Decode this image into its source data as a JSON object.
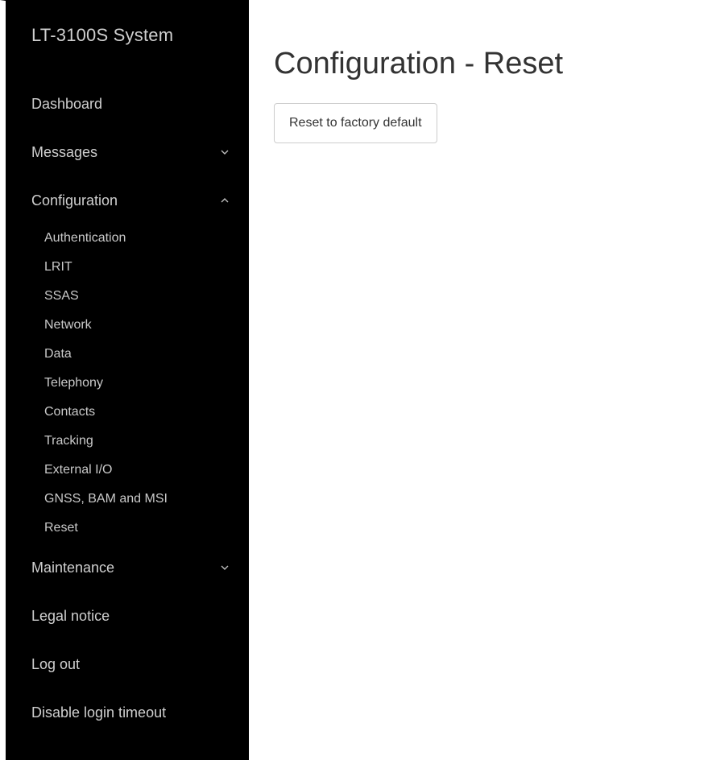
{
  "sidebar": {
    "brand": "LT-3100S System",
    "items": {
      "dashboard": "Dashboard",
      "messages": "Messages",
      "configuration": "Configuration",
      "maintenance": "Maintenance",
      "legal": "Legal notice",
      "logout": "Log out",
      "disable_timeout": "Disable login timeout"
    },
    "icons": {
      "collapsed": "chevron-down-icon",
      "expanded": "chevron-up-icon"
    },
    "configuration_submenu": [
      "Authentication",
      "LRIT",
      "SSAS",
      "Network",
      "Data",
      "Telephony",
      "Contacts",
      "Tracking",
      "External I/O",
      "GNSS, BAM and MSI",
      "Reset"
    ]
  },
  "main": {
    "title": "Configuration - Reset",
    "reset_button": "Reset to factory default"
  }
}
